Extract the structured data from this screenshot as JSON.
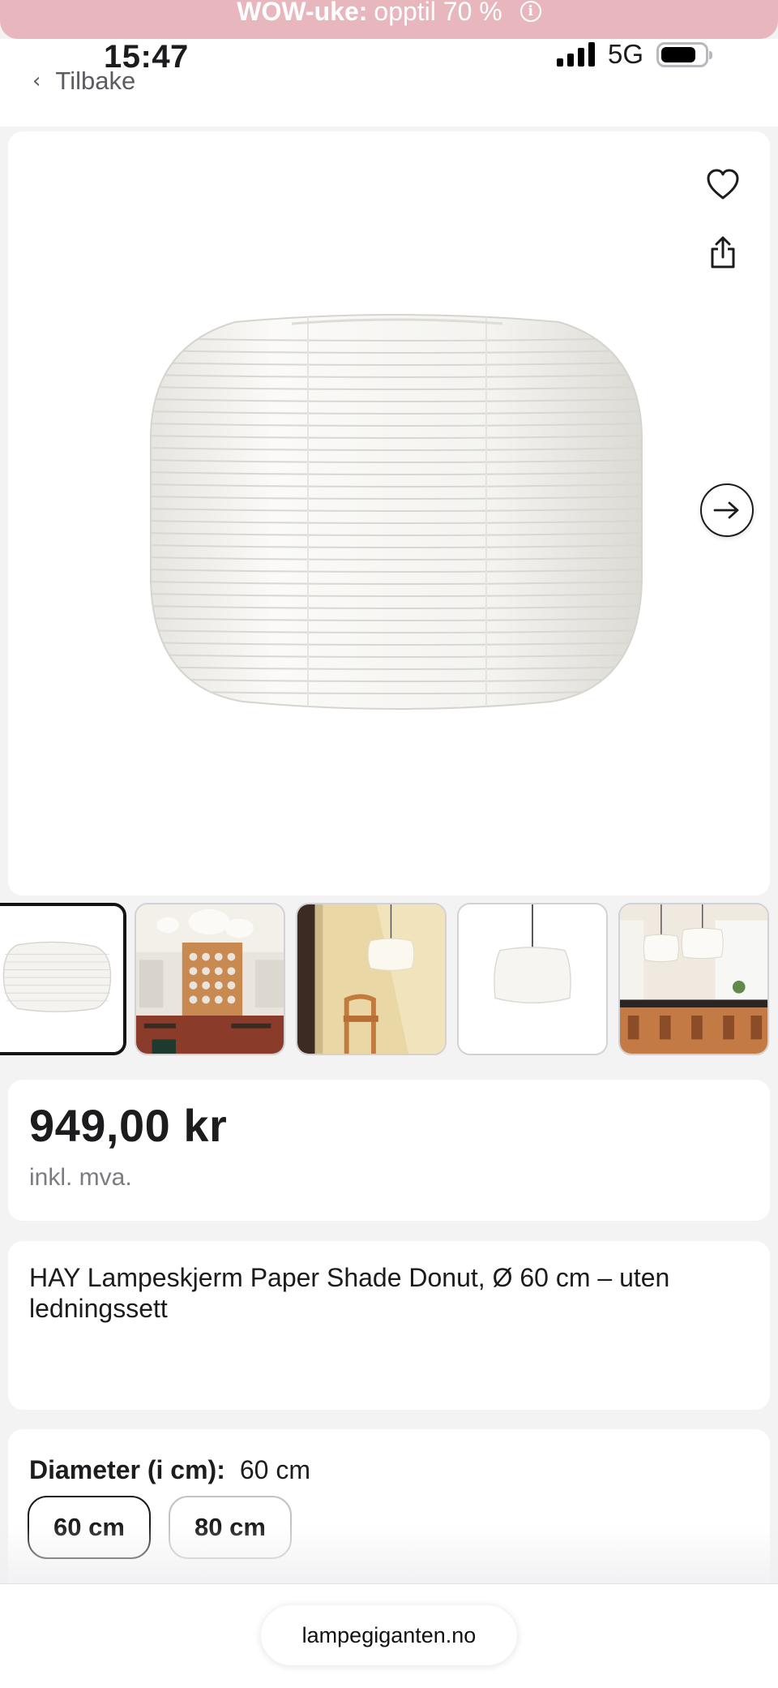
{
  "promo": {
    "bold": "WOW-uke:",
    "text": "opptil 70 %",
    "icon": "info-icon"
  },
  "status_bar": {
    "time": "15:47",
    "network": "5G",
    "battery_level": 0.8
  },
  "nav": {
    "back_label": "Tilbake"
  },
  "gallery": {
    "icons": {
      "favorite": "heart-icon",
      "share": "share-icon",
      "next": "arrow-right-icon"
    },
    "thumbnail_count": 5,
    "active_index": 0
  },
  "price": {
    "amount": "949,00 kr",
    "vat_note": "inkl. mva."
  },
  "product": {
    "title": "HAY Lampeskjerm Paper Shade Donut, Ø 60 cm – uten ledningssett"
  },
  "options": {
    "label": "Diameter (i cm):",
    "selected": "60 cm",
    "choices": [
      "60 cm",
      "80 cm"
    ]
  },
  "browser": {
    "url": "lampegiganten.no"
  }
}
